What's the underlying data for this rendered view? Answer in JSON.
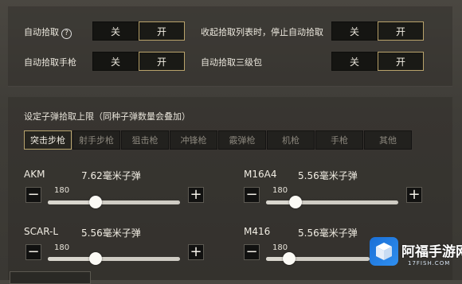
{
  "pickup": {
    "auto_pickup": {
      "label": "自动拾取",
      "off": "关",
      "on": "开"
    },
    "stop_on_collapse": {
      "label": "收起拾取列表时，停止自动拾取",
      "off": "关",
      "on": "开"
    },
    "auto_pickup_pistol": {
      "label": "自动拾取手枪",
      "off": "关",
      "on": "开"
    },
    "auto_pickup_lvl3_bag": {
      "label": "自动拾取三级包",
      "off": "关",
      "on": "开"
    }
  },
  "help_glyph": "?",
  "ammo_limit": {
    "title": "设定子弹拾取上限（同种子弹数量会叠加）",
    "tabs": [
      "突击步枪",
      "射手步枪",
      "狙击枪",
      "冲锋枪",
      "霰弹枪",
      "机枪",
      "手枪",
      "其他"
    ],
    "active_tab": 0
  },
  "weapons": [
    {
      "name": "AKM",
      "ammo": "7.62毫米子弹",
      "value": "180",
      "fraction": 0.36
    },
    {
      "name": "M16A4",
      "ammo": "5.56毫米子弹",
      "value": "180",
      "fraction": 0.22
    },
    {
      "name": "SCAR-L",
      "ammo": "5.56毫米子弹",
      "value": "180",
      "fraction": 0.36
    },
    {
      "name": "M416",
      "ammo": "5.56毫米子弹",
      "value": "180",
      "fraction": 0.22
    }
  ],
  "buttons": {
    "minus": "−",
    "plus": "+"
  },
  "watermark": {
    "name": "阿福手游网",
    "url": "17FISH.COM"
  },
  "colors": {
    "accent_border": "#b9a36b",
    "watermark_blue": "#1f7ee2"
  }
}
